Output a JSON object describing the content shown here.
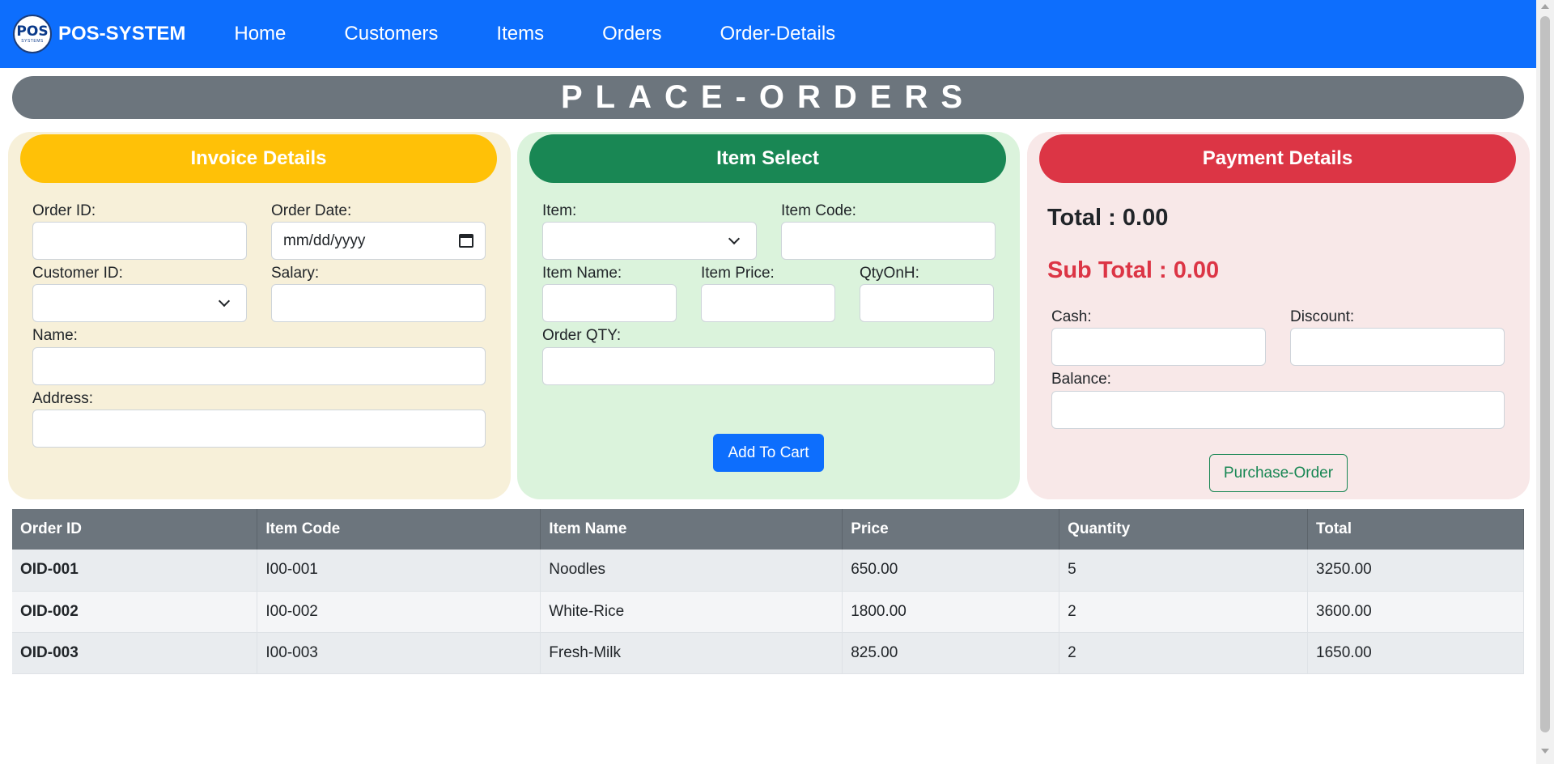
{
  "brand": {
    "logo_text": "POS",
    "logo_sub": "SYSTEMS",
    "name": "POS-SYSTEM"
  },
  "nav": {
    "links": [
      "Home",
      "Customers",
      "Items",
      "Orders",
      "Order-Details"
    ]
  },
  "page_title": "PLACE-ORDERS",
  "invoice": {
    "heading": "Invoice Details",
    "order_id_label": "Order ID:",
    "order_id_value": "",
    "order_date_label": "Order Date:",
    "order_date_value": "mm/dd/yyyy",
    "customer_id_label": "Customer ID:",
    "customer_id_value": "",
    "salary_label": "Salary:",
    "salary_value": "",
    "name_label": "Name:",
    "name_value": "",
    "address_label": "Address:",
    "address_value": ""
  },
  "item_select": {
    "heading": "Item Select",
    "item_label": "Item:",
    "item_value": "",
    "item_code_label": "Item Code:",
    "item_code_value": "",
    "item_name_label": "Item Name:",
    "item_name_value": "",
    "item_price_label": "Item Price:",
    "item_price_value": "",
    "qty_on_hand_label": "QtyOnH:",
    "qty_on_hand_value": "",
    "order_qty_label": "Order QTY:",
    "order_qty_value": "",
    "add_button": "Add To Cart"
  },
  "payment": {
    "heading": "Payment Details",
    "total": "Total : 0.00",
    "sub_total": "Sub Total : 0.00",
    "cash_label": "Cash:",
    "cash_value": "",
    "discount_label": "Discount:",
    "discount_value": "",
    "balance_label": "Balance:",
    "balance_value": "",
    "purchase_button": "Purchase-Order"
  },
  "colors": {
    "navbar": "#0d6efd",
    "title_bar": "#6c757d",
    "invoice_head": "#ffc107",
    "item_head": "#198754",
    "payment_head": "#dc3545"
  },
  "table": {
    "headers": [
      "Order ID",
      "Item Code",
      "Item Name",
      "Price",
      "Quantity",
      "Total"
    ],
    "rows": [
      [
        "OID-001",
        "I00-001",
        "Noodles",
        "650.00",
        "5",
        "3250.00"
      ],
      [
        "OID-002",
        "I00-002",
        "White-Rice",
        "1800.00",
        "2",
        "3600.00"
      ],
      [
        "OID-003",
        "I00-003",
        "Fresh-Milk",
        "825.00",
        "2",
        "1650.00"
      ]
    ]
  }
}
